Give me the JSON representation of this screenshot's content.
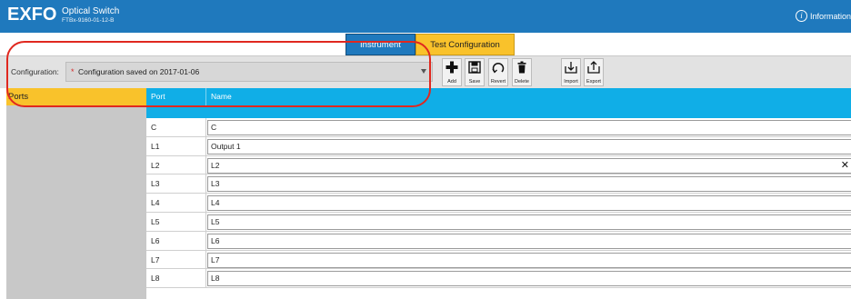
{
  "header": {
    "logo": "EXFO",
    "product_name": "Optical Switch",
    "model": "FTBx-9160-01-12-B",
    "info_label": "Information",
    "info_icon": "info-icon"
  },
  "tabs": [
    {
      "label": "Instrument",
      "active": false
    },
    {
      "label": "Test Configuration",
      "active": true
    }
  ],
  "toolbar": {
    "config_label": "Configuration:",
    "config_modified_marker": "*",
    "config_value": "Configuration saved on 2017-01-06",
    "buttons": [
      {
        "label": "Add",
        "icon": "plus-icon"
      },
      {
        "label": "Save",
        "icon": "floppy-icon"
      },
      {
        "label": "Revert",
        "icon": "revert-icon"
      },
      {
        "label": "Delete",
        "icon": "trash-icon"
      },
      {
        "label": "Import",
        "icon": "import-icon"
      },
      {
        "label": "Export",
        "icon": "export-icon"
      }
    ]
  },
  "sidebar": {
    "title": "Ports"
  },
  "table": {
    "columns": [
      "Port",
      "Name"
    ],
    "rows": [
      {
        "port": "C",
        "name": "C"
      },
      {
        "port": "L1",
        "name": "Output 1"
      },
      {
        "port": "L2",
        "name": "L2"
      },
      {
        "port": "L3",
        "name": "L3"
      },
      {
        "port": "L4",
        "name": "L4"
      },
      {
        "port": "L5",
        "name": "L5"
      },
      {
        "port": "L6",
        "name": "L6"
      },
      {
        "port": "L7",
        "name": "L7"
      },
      {
        "port": "L8",
        "name": "L8"
      }
    ],
    "clear_glyph": "✕"
  },
  "colors": {
    "header_blue": "#1f79bd",
    "accent_yellow": "#f9c22b",
    "table_head_cyan": "#10aee7",
    "highlight_red": "#e0281f"
  }
}
